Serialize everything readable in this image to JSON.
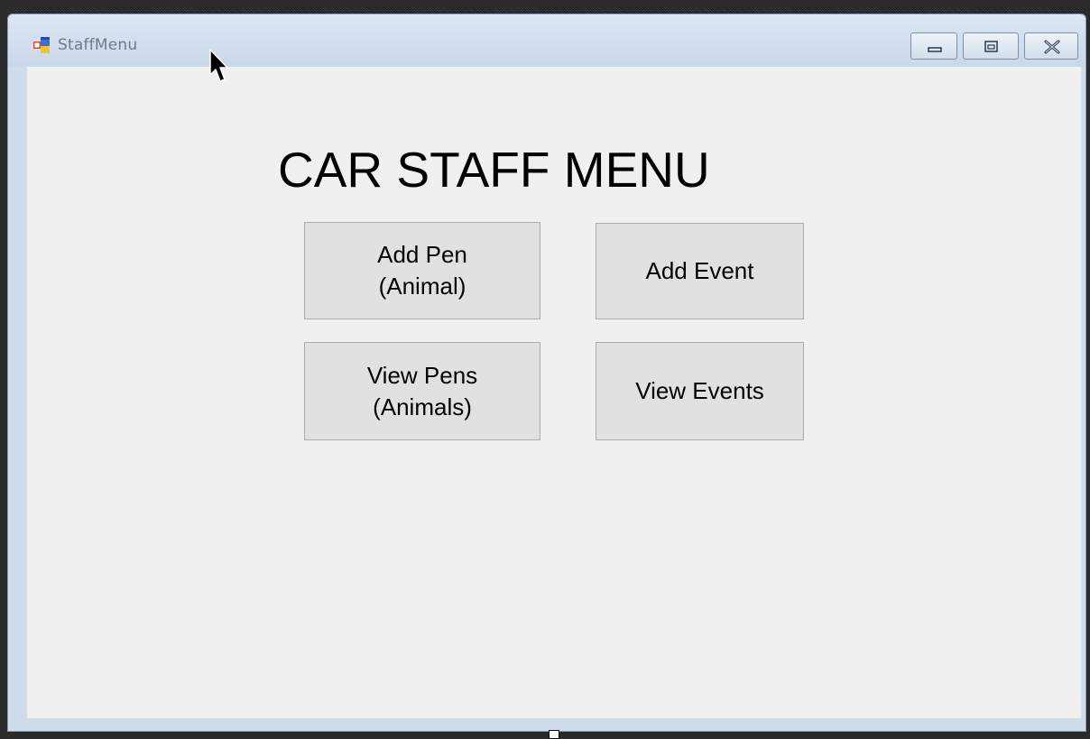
{
  "window": {
    "title": "StaffMenu",
    "icon": "winforms-app-icon",
    "controls": {
      "minimize_icon": "minimize-icon",
      "maximize_icon": "maximize-icon",
      "close_icon": "close-icon"
    }
  },
  "form": {
    "heading": "CAR STAFF MENU",
    "buttons": {
      "add_pen": "Add Pen\n(Animal)",
      "add_event": "Add Event",
      "view_pens": "View Pens\n(Animals)",
      "view_events": "View Events"
    }
  },
  "colors": {
    "form_background": "#f0f0f0",
    "button_face": "#e1e1e1",
    "button_border": "#adadad",
    "titlebar": "#dbe6f3"
  }
}
